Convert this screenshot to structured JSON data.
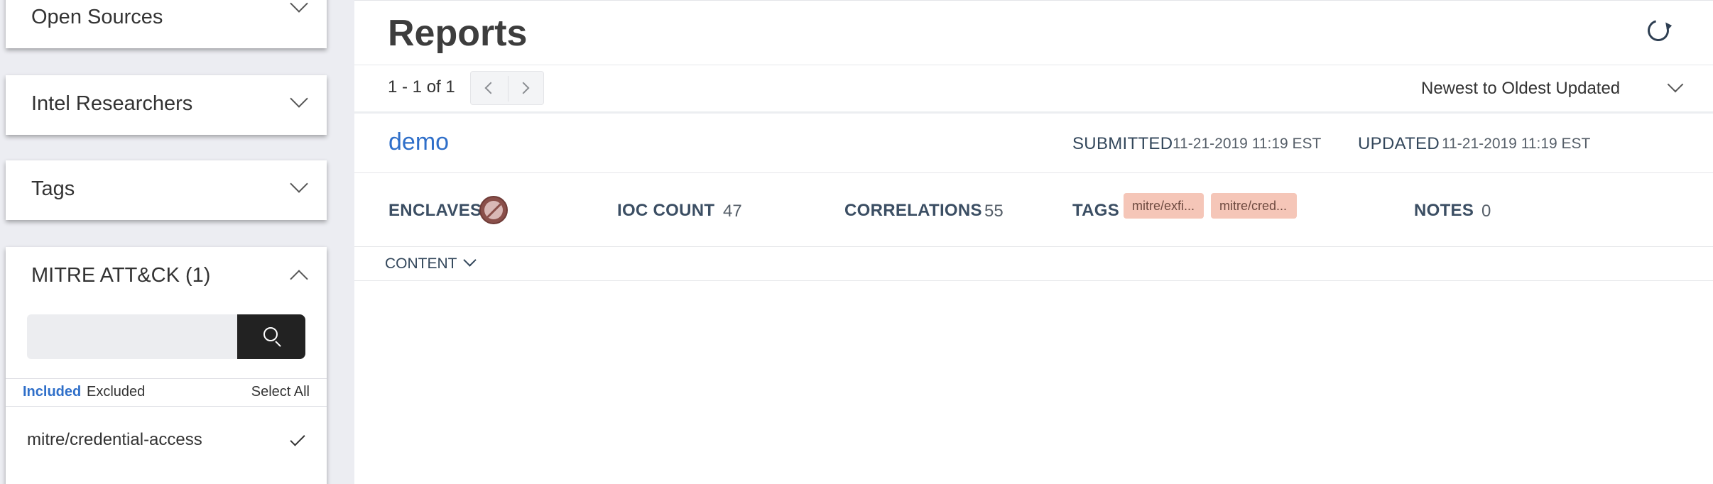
{
  "sidebar": {
    "cards": [
      {
        "title": "Open Sources"
      },
      {
        "title": "Intel Researchers"
      },
      {
        "title": "Tags"
      },
      {
        "title": "MITRE ATT&CK (1)"
      }
    ],
    "mitre": {
      "search_value": "",
      "tabs": {
        "included": "Included",
        "excluded": "Excluded"
      },
      "select_all": "Select All",
      "items": [
        {
          "label": "mitre/credential-access",
          "checked": true
        }
      ]
    }
  },
  "main": {
    "title": "Reports",
    "pagination": {
      "summary": "1 - 1 of 1"
    },
    "sort": {
      "selected": "Newest to Oldest Updated"
    },
    "report": {
      "name": "demo",
      "submitted_label": "SUBMITTED",
      "submitted_value": "11-21-2019 11:19 EST",
      "updated_label": "UPDATED",
      "updated_value": "11-21-2019 11:19 EST",
      "enclaves_label": "ENCLAVES",
      "ioc_label": "IOC COUNT",
      "ioc_value": "47",
      "correlations_label": "CORRELATIONS",
      "correlations_value": "55",
      "tags_label": "TAGS",
      "tags": [
        "mitre/exfi...",
        "mitre/cred..."
      ],
      "notes_label": "NOTES",
      "notes_value": "0",
      "content_label": "CONTENT"
    }
  },
  "colors": {
    "accent_blue": "#2f6fc9",
    "tag_bg": "#f5c6b8",
    "search_button_bg": "#222222",
    "enclave_icon": "#8a4f4a"
  },
  "icons": [
    "chevron-down-icon",
    "chevron-up-icon",
    "search-icon",
    "checkmark-icon",
    "refresh-icon",
    "chevron-left-icon",
    "chevron-right-icon",
    "enclave-restricted-icon"
  ]
}
